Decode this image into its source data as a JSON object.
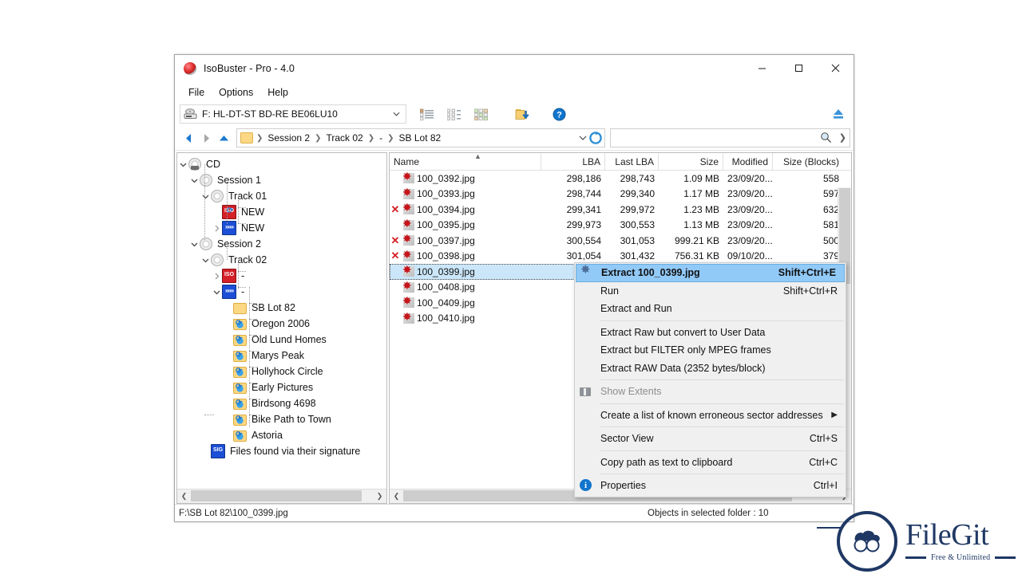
{
  "window": {
    "title": "IsoBuster - Pro - 4.0",
    "app_icon": "isobuster-disc-icon",
    "minimize_label": "Minimize",
    "maximize_label": "Maximize",
    "close_label": "Close"
  },
  "menubar": {
    "items": [
      {
        "label": "File"
      },
      {
        "label": "Options"
      },
      {
        "label": "Help"
      }
    ]
  },
  "devicebar": {
    "drive": "F: HL-DT-ST  BD-RE  BE06LU10",
    "icons": [
      {
        "name": "list-view-icon"
      },
      {
        "name": "detail-view-icon"
      },
      {
        "name": "grid-view-icon"
      },
      {
        "name": "extract-folder-icon"
      },
      {
        "name": "help-icon"
      }
    ],
    "eject_label": "Eject"
  },
  "navbar": {
    "back_label": "Back",
    "forward_label": "Forward",
    "up_label": "Up",
    "breadcrumbs": [
      {
        "label": "Session 2"
      },
      {
        "label": "Track 02"
      },
      {
        "label": "-"
      },
      {
        "label": "SB Lot 82"
      }
    ],
    "refresh_label": "Refresh",
    "search": {
      "value": "",
      "placeholder": ""
    }
  },
  "tree": {
    "nodes": [
      {
        "label": "CD",
        "indent": 0,
        "twist": "down",
        "icon": "disc-cd-icon"
      },
      {
        "label": "Session 1",
        "indent": 1,
        "twist": "down",
        "icon": "disc-icon"
      },
      {
        "label": "Track 01",
        "indent": 2,
        "twist": "down",
        "icon": "disc-icon"
      },
      {
        "label": "NEW",
        "indent": 3,
        "twist": "none",
        "icon": "iso-link-icon"
      },
      {
        "label": "NEW",
        "indent": 3,
        "twist": "right",
        "icon": "udf-icon"
      },
      {
        "label": "Session 2",
        "indent": 1,
        "twist": "down",
        "icon": "disc-icon"
      },
      {
        "label": "Track 02",
        "indent": 2,
        "twist": "down",
        "icon": "disc-icon"
      },
      {
        "label": "-",
        "indent": 3,
        "twist": "right",
        "icon": "iso-icon"
      },
      {
        "label": "-",
        "indent": 3,
        "twist": "down",
        "icon": "udf-icon"
      },
      {
        "label": "SB Lot 82",
        "indent": 4,
        "twist": "none",
        "icon": "folder-icon"
      },
      {
        "label": "Oregon 2006",
        "indent": 4,
        "twist": "none",
        "icon": "folder-link-icon"
      },
      {
        "label": "Old Lund Homes",
        "indent": 4,
        "twist": "none",
        "icon": "folder-link-icon"
      },
      {
        "label": "Marys Peak",
        "indent": 4,
        "twist": "none",
        "icon": "folder-link-icon"
      },
      {
        "label": "Hollyhock Circle",
        "indent": 4,
        "twist": "none",
        "icon": "folder-link-icon"
      },
      {
        "label": "Early Pictures",
        "indent": 4,
        "twist": "none",
        "icon": "folder-link-icon"
      },
      {
        "label": "Birdsong 4698",
        "indent": 4,
        "twist": "none",
        "icon": "folder-link-icon"
      },
      {
        "label": "Bike Path to Town",
        "indent": 4,
        "twist": "none",
        "icon": "folder-link-icon"
      },
      {
        "label": "Astoria",
        "indent": 4,
        "twist": "none",
        "icon": "folder-link-icon"
      },
      {
        "label": "Files found via their signature",
        "indent": 2,
        "twist": "none",
        "icon": "signature-icon"
      }
    ]
  },
  "filelist": {
    "columns": [
      {
        "label": "Name",
        "align": "left"
      },
      {
        "label": "LBA",
        "align": "right"
      },
      {
        "label": "Last LBA",
        "align": "right"
      },
      {
        "label": "Size",
        "align": "right"
      },
      {
        "label": "Modified",
        "align": "right"
      },
      {
        "label": "Size (Blocks)",
        "align": "right"
      }
    ],
    "sort_indicator": "ascending",
    "rows": [
      {
        "flag": "",
        "name": "100_0392.jpg",
        "lba": "298,186",
        "last_lba": "298,743",
        "size": "1.09 MB",
        "modified": "23/09/20...",
        "blocks": "558",
        "selected": false
      },
      {
        "flag": "",
        "name": "100_0393.jpg",
        "lba": "298,744",
        "last_lba": "299,340",
        "size": "1.17 MB",
        "modified": "23/09/20...",
        "blocks": "597",
        "selected": false
      },
      {
        "flag": "✕",
        "name": "100_0394.jpg",
        "lba": "299,341",
        "last_lba": "299,972",
        "size": "1.23 MB",
        "modified": "23/09/20...",
        "blocks": "632",
        "selected": false
      },
      {
        "flag": "",
        "name": "100_0395.jpg",
        "lba": "299,973",
        "last_lba": "300,553",
        "size": "1.13 MB",
        "modified": "23/09/20...",
        "blocks": "581",
        "selected": false
      },
      {
        "flag": "✕",
        "name": "100_0397.jpg",
        "lba": "300,554",
        "last_lba": "301,053",
        "size": "999.21 KB",
        "modified": "23/09/20...",
        "blocks": "500",
        "selected": false
      },
      {
        "flag": "✕",
        "name": "100_0398.jpg",
        "lba": "301,054",
        "last_lba": "301,432",
        "size": "756.31 KB",
        "modified": "09/10/20...",
        "blocks": "379",
        "selected": false
      },
      {
        "flag": "",
        "name": "100_0399.jpg",
        "lba": "",
        "last_lba": "",
        "size": "",
        "modified": "",
        "blocks": "",
        "selected": true
      },
      {
        "flag": "",
        "name": "100_0408.jpg",
        "lba": "",
        "last_lba": "",
        "size": "",
        "modified": "",
        "blocks": "",
        "selected": false
      },
      {
        "flag": "",
        "name": "100_0409.jpg",
        "lba": "",
        "last_lba": "",
        "size": "",
        "modified": "",
        "blocks": "",
        "selected": false
      },
      {
        "flag": "",
        "name": "100_0410.jpg",
        "lba": "",
        "last_lba": "",
        "size": "",
        "modified": "",
        "blocks": "",
        "selected": false
      }
    ]
  },
  "contextmenu": {
    "items": [
      {
        "type": "item",
        "label": "Extract 100_0399.jpg",
        "accel": "Shift+Ctrl+E",
        "icon": "extract-icon",
        "highlighted": true,
        "disabled": false,
        "submenu": false
      },
      {
        "type": "item",
        "label": "Run",
        "accel": "Shift+Ctrl+R",
        "icon": "",
        "highlighted": false,
        "disabled": false,
        "submenu": false
      },
      {
        "type": "item",
        "label": "Extract and Run",
        "accel": "",
        "icon": "",
        "highlighted": false,
        "disabled": false,
        "submenu": false
      },
      {
        "type": "sep"
      },
      {
        "type": "item",
        "label": "Extract Raw but convert to User Data",
        "accel": "",
        "icon": "",
        "highlighted": false,
        "disabled": false,
        "submenu": false
      },
      {
        "type": "item",
        "label": "Extract but FILTER only MPEG frames",
        "accel": "",
        "icon": "",
        "highlighted": false,
        "disabled": false,
        "submenu": false
      },
      {
        "type": "item",
        "label": "Extract RAW Data (2352 bytes/block)",
        "accel": "",
        "icon": "",
        "highlighted": false,
        "disabled": false,
        "submenu": false
      },
      {
        "type": "sep"
      },
      {
        "type": "item",
        "label": "Show Extents",
        "accel": "",
        "icon": "extents-icon",
        "highlighted": false,
        "disabled": true,
        "submenu": false
      },
      {
        "type": "sep"
      },
      {
        "type": "item",
        "label": "Create a list of known erroneous sector addresses",
        "accel": "",
        "icon": "",
        "highlighted": false,
        "disabled": false,
        "submenu": true
      },
      {
        "type": "sep"
      },
      {
        "type": "item",
        "label": "Sector View",
        "accel": "Ctrl+S",
        "icon": "",
        "highlighted": false,
        "disabled": false,
        "submenu": false
      },
      {
        "type": "sep"
      },
      {
        "type": "item",
        "label": "Copy path as text to clipboard",
        "accel": "Ctrl+C",
        "icon": "",
        "highlighted": false,
        "disabled": false,
        "submenu": false
      },
      {
        "type": "sep"
      },
      {
        "type": "item",
        "label": "Properties",
        "accel": "Ctrl+I",
        "icon": "info-icon",
        "highlighted": false,
        "disabled": false,
        "submenu": false
      }
    ]
  },
  "statusbar": {
    "path": "F:\\SB Lot 82\\100_0399.jpg",
    "objects": "Objects in selected folder : 10"
  },
  "watermark": {
    "name": "FileGit",
    "tagline": "Free & Unlimited"
  },
  "colors": {
    "selection": "#cbe6f9",
    "menu_highlight": "#91c9f7",
    "error_red": "#d42027",
    "brand_navy": "#1f3864",
    "accent_blue": "#1c4fd6"
  }
}
